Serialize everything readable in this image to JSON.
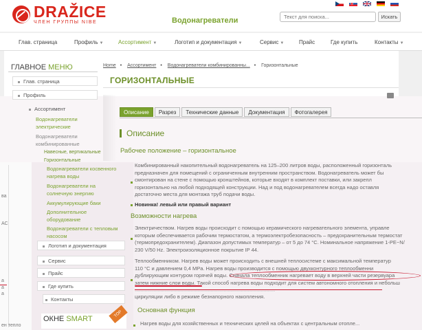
{
  "brand": {
    "name": "DRAŽICE",
    "sub": "ЧЛЕН ГРУППЫ NIBE",
    "section": "Водонагреватели",
    "colors": {
      "red": "#d9261c",
      "green": "#7aa22d"
    }
  },
  "flags": [
    "cz",
    "sk",
    "gb",
    "de",
    "ru"
  ],
  "search": {
    "placeholder": "Текст для поиска...",
    "button": "Искать"
  },
  "topnav": [
    {
      "label": "Глав. страница",
      "caret": false
    },
    {
      "label": "Профиль",
      "caret": true
    },
    {
      "label": "Ассортимент",
      "caret": true,
      "active": true
    },
    {
      "label": "Логотип и документация",
      "caret": true
    },
    {
      "label": "Сервис",
      "caret": true
    },
    {
      "label": "Прайс",
      "caret": false
    },
    {
      "label": "Где купить",
      "caret": false
    },
    {
      "label": "Контакты",
      "caret": true
    }
  ],
  "sidebar": {
    "title": "ГЛАВНОЕ",
    "title_accent": "МЕНЮ",
    "items": [
      {
        "label": "Глав. страница"
      },
      {
        "label": "Профиль"
      },
      {
        "label": "Ассортимент"
      },
      {
        "label": "Водонагреватели"
      },
      {
        "label": "электрические"
      },
      {
        "label": "Водонагреватели"
      },
      {
        "label": "комбинированные"
      },
      {
        "label": "Навесные, вертикальные"
      },
      {
        "label": "Горизонтальные"
      },
      {
        "label": "Водонагреватели косвенного"
      },
      {
        "label": "нагрева воды"
      },
      {
        "label": "Водонагреватели на"
      },
      {
        "label": "солнечную энергию"
      },
      {
        "label": "Аккумулирующие баки"
      },
      {
        "label": "Дополнительное"
      },
      {
        "label": "оборудование"
      },
      {
        "label": "Водонагреватели с тепловым"
      },
      {
        "label": "насосом"
      },
      {
        "label": "Логотип и документация"
      },
      {
        "label": "Сервис"
      },
      {
        "label": "Прайс"
      },
      {
        "label": "Где купить"
      },
      {
        "label": "Контакты"
      }
    ],
    "okne_title": "ОКНЕ",
    "okne_accent": "SMART",
    "badge": "TOP"
  },
  "breadcrumb": [
    "Home",
    "Ассортимент",
    "Водонагреватели комбинированны...",
    "Горизонтальные"
  ],
  "page_title": "ГОРИЗОНТАЛЬНЫЕ",
  "tabs": [
    "Описание",
    "Разрез",
    "Технические данные",
    "Документация",
    "Фотогалерея"
  ],
  "content": {
    "heading": "Описание",
    "sub1": "Рабочее положение – горизонтальное",
    "p1_lines": [
      "Комбинированный накопительный водонагреватель на 125–200 литров воды, расположенный горизонталь",
      "предназначен для помещений с ограниченным внутренним пространством. Водонагреватель может бы",
      "смонтирован на стене с помощью кронштейнов, которые входят в комплект поставки, или закрепл",
      "горизонтально на любой подходящей конструкции. Над и под водонагревателем всегда надо оставля",
      "достаточно места для монтажа труб подачи воды."
    ],
    "p1_bold": "Новинка! левый или правый вариант",
    "sub2": "Возможности нагрева",
    "p2_lines": [
      "Электричеством. Нагрев воды происходит с помощью керамического нагревательного элемента, управле",
      "которым обеспечивается рабочим термостатом, а термоэлектробезопасность – предохранительным термостат",
      "(термопредохранителем). Диапазон допустимых температур – от 5 до 74 °С. Номинальное напряжение 1-PE~N/",
      "230 V/50 Hz. Электроизоляционное покрытие IP 44."
    ],
    "p3_lines": [
      "Теплообменником. Нагрев воды может происходить с внешней теплосистеме с максимальной температур",
      "110 °С и давлением 0,4 MPa. Нагрев воды производится с помощью двухконтурного теплообменни",
      "дублирующим контуром горячей воды. Сначала теплообменник нагревает воду в верхней части резервуара",
      "затем нижние слои воды. Такой способ нагрева воды подходит для систем автономного отопления и небольш",
      "..................................................................................................",
      "циркуляции либо в режиме безнапорного накопления."
    ],
    "sub3": "Основная функция",
    "p4_line": "Нагрев воды для хозяйственных и технических целей на объектах с центральным отопле..."
  },
  "strip": [
    "ва",
    "АС",
    "а",
    "а",
    "а",
    "ен тепло"
  ]
}
